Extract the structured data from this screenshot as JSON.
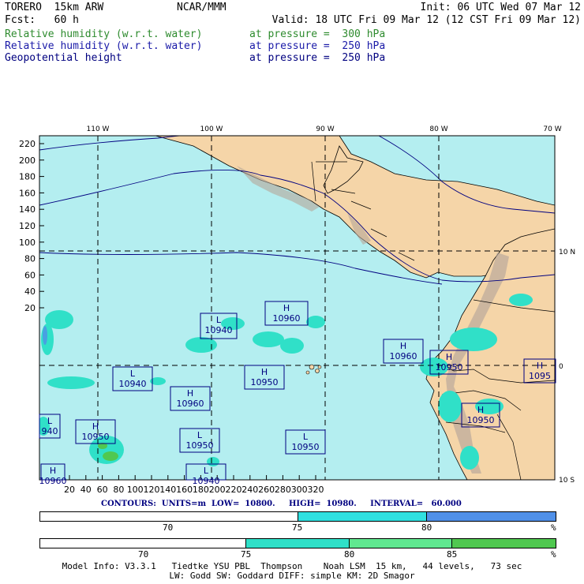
{
  "header": {
    "model": "TORERO  15km ARW",
    "org": "NCAR/MMM",
    "init": "Init: 06 UTC Wed 07 Mar 12",
    "fcst": "Fcst:   60 h",
    "valid": "Valid: 18 UTC Fri 09 Mar 12 (12 CST Fri 09 Mar 12)",
    "fields": [
      {
        "name": "Relative humidity (w.r.t. water)",
        "level": "at pressure =  300 hPa",
        "color": "#2e8b2e"
      },
      {
        "name": "Relative humidity (w.r.t. water)",
        "level": "at pressure =  250 hPa",
        "color": "#1a1aa8"
      },
      {
        "name": "Geopotential height",
        "level": "at pressure =  250 hPa",
        "color": "#000080"
      }
    ]
  },
  "map": {
    "lon_labels": [
      "110 W",
      "100 W",
      "90 W",
      "80 W",
      "70 W"
    ],
    "lat_labels": [
      "10 N",
      "0",
      "10 S"
    ],
    "y_ticks": [
      "220",
      "200",
      "180",
      "160",
      "140",
      "120",
      "100",
      "80",
      "60",
      "40",
      "20"
    ],
    "x_ticks": [
      "20",
      "40",
      "60",
      "80",
      "100",
      "120",
      "140",
      "160",
      "180",
      "200",
      "220",
      "240",
      "260",
      "280",
      "300",
      "320"
    ],
    "centers": [
      {
        "type": "H",
        "value": "10960"
      },
      {
        "type": "L",
        "value": "10940"
      },
      {
        "type": "H",
        "value": "10960"
      },
      {
        "type": "L",
        "value": "10940"
      },
      {
        "type": "H",
        "value": "10950"
      },
      {
        "type": "H",
        "value": "10960"
      },
      {
        "type": "H",
        "value": "10950"
      },
      {
        "type": "H",
        "value": "10950"
      },
      {
        "type": "H",
        "value": "10960"
      },
      {
        "type": "L",
        "value": "10950"
      },
      {
        "type": "H",
        "value": "10950"
      },
      {
        "type": "H",
        "value": "1095"
      },
      {
        "type": "L",
        "value": "940"
      },
      {
        "type": "L",
        "value": "10950"
      },
      {
        "type": "L",
        "value": "10940"
      }
    ]
  },
  "contours_line": "CONTOURS:  UNITS=m  LOW=  10800.     HIGH=  10980.     INTERVAL=   60.000",
  "colorbar1": {
    "labels": [
      "70",
      "75",
      "80",
      "%"
    ],
    "colors": [
      "#ffffff",
      "#30e0e0",
      "#5090e8"
    ]
  },
  "colorbar2": {
    "labels": [
      "70",
      "75",
      "80",
      "85",
      "%"
    ],
    "colors": [
      "#ffffff",
      "#30e0c8",
      "#60e890",
      "#50c850"
    ]
  },
  "footer": {
    "line1": "Model Info: V3.3.1   Tiedtke YSU PBL  Thompson    Noah LSM  15 km,   44 levels,   73 sec",
    "line2": "LW: Godd SW: Goddard DIFF: simple KM: 2D Smagor"
  }
}
